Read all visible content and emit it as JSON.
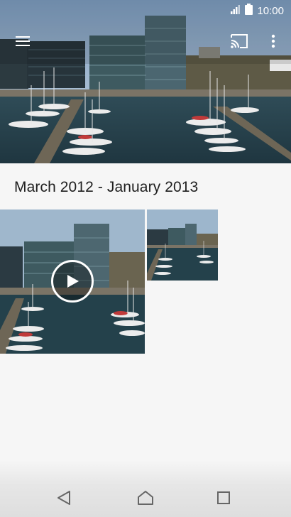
{
  "status_bar": {
    "time": "10:00"
  },
  "toolbar": {
    "menu_icon": "hamburger-menu-icon",
    "cast_icon": "cast-icon",
    "more_icon": "more-vert-icon"
  },
  "section": {
    "title": "March 2012 - January 2013"
  },
  "media": [
    {
      "kind": "video",
      "play_icon": "play-icon"
    },
    {
      "kind": "photo"
    }
  ],
  "nav": {
    "back_icon": "back-icon",
    "home_icon": "home-icon",
    "recents_icon": "recents-icon"
  }
}
